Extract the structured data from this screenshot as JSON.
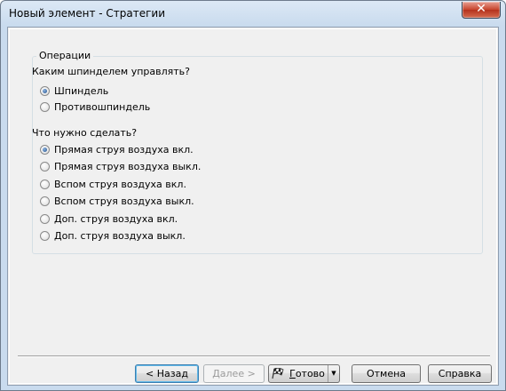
{
  "window": {
    "title": "Новый элемент - Стратегии",
    "close_icon": "close-icon"
  },
  "group": {
    "title": "Операции"
  },
  "spindle": {
    "question": "Каким шпинделем управлять?",
    "options": [
      {
        "label": "Шпиндель",
        "checked": true
      },
      {
        "label": "Противошпиндель",
        "checked": false
      }
    ]
  },
  "action": {
    "question": "Что нужно сделать?",
    "options": [
      {
        "label": "Прямая струя воздуха вкл.",
        "checked": true
      },
      {
        "label": "Прямая струя воздуха выкл.",
        "checked": false
      },
      {
        "label": "Вспом струя воздуха вкл.",
        "checked": false
      },
      {
        "label": "Вспом струя воздуха выкл.",
        "checked": false
      },
      {
        "label": "Доп. струя воздуха вкл.",
        "checked": false
      },
      {
        "label": "Доп. струя воздуха выкл.",
        "checked": false
      }
    ]
  },
  "buttons": {
    "back": "< Назад",
    "next": "Далее >",
    "finish_first": "Г",
    "finish_rest": "отово",
    "cancel": "Отмена",
    "help": "Справка"
  }
}
